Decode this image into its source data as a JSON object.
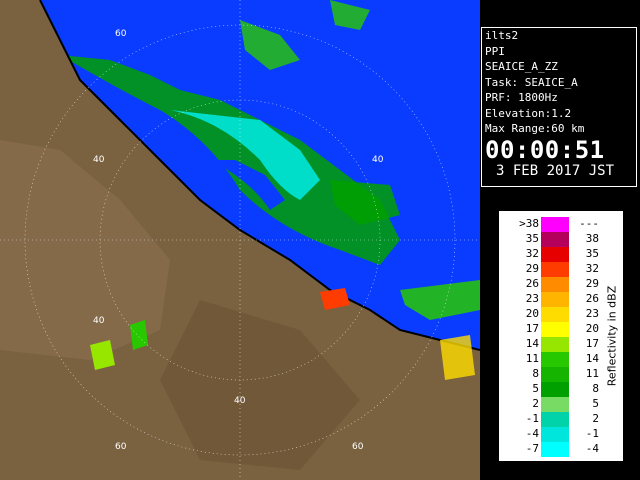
{
  "radar_info": {
    "site": "ilts2",
    "product": "PPI",
    "product_id": "SEAICE_A_ZZ",
    "task": "Task: SEAICE_A",
    "prf": "PRF: 1800Hz",
    "elevation": "Elevation:1.2",
    "max_range": "Max Range:60 km",
    "time": "00:00:51",
    "date": "3 FEB 2017 JST"
  },
  "legend": {
    "title": "Reflectivity in dBZ",
    "rows": [
      {
        "low": ">38",
        "high": "---",
        "color": "#ff00ff"
      },
      {
        "low": "35",
        "high": "38",
        "color": "#b4005a"
      },
      {
        "low": "32",
        "high": "35",
        "color": "#e60000"
      },
      {
        "low": "29",
        "high": "32",
        "color": "#ff3c00"
      },
      {
        "low": "26",
        "high": "29",
        "color": "#ff8c00"
      },
      {
        "low": "23",
        "high": "26",
        "color": "#ffb400"
      },
      {
        "low": "20",
        "high": "23",
        "color": "#ffdc00"
      },
      {
        "low": "17",
        "high": "20",
        "color": "#ffff00"
      },
      {
        "low": "14",
        "high": "17",
        "color": "#96e600"
      },
      {
        "low": "11",
        "high": "14",
        "color": "#28c800"
      },
      {
        "low": "8",
        "high": "11",
        "color": "#14b400"
      },
      {
        "low": "5",
        "high": "8",
        "color": "#00a000"
      },
      {
        "low": "2",
        "high": "5",
        "color": "#78dc64"
      },
      {
        "low": "-1",
        "high": "2",
        "color": "#00d2aa"
      },
      {
        "low": "-4",
        "high": "-1",
        "color": "#00e6dc"
      },
      {
        "low": "-7",
        "high": "-4",
        "color": "#00ffff"
      }
    ]
  },
  "range_rings": {
    "labels": [
      "60",
      "40",
      "40",
      "40",
      "40",
      "60"
    ]
  },
  "colors": {
    "sea": "#0a3cff",
    "land": "#7a6240",
    "coastline": "#000000"
  }
}
